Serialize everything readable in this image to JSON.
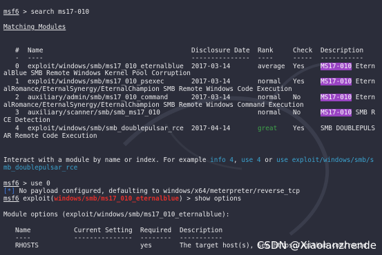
{
  "prompt": {
    "label": "msf6",
    "gt": " > ",
    "exploit_word": "exploit(",
    "exploit_module": "windows/smb/ms17_010_eternalblue",
    "close": ") > "
  },
  "commands": {
    "search": "search ms17-010",
    "use": "use 0",
    "show": "show options"
  },
  "matching": {
    "title": "Matching Modules",
    "headers": {
      "num": "#",
      "name": "Name",
      "date": "Disclosure Date",
      "rank": "Rank",
      "check": "Check",
      "desc": "Description"
    },
    "dashes": {
      "num": "-",
      "name": "----",
      "date": "---------------",
      "rank": "----",
      "check": "-----",
      "desc": "-----------"
    },
    "rows": [
      {
        "num": "0",
        "name": "exploit/windows/smb/ms17_010_eternalblue",
        "date": "2017-03-14",
        "rank": "average",
        "check": "Yes",
        "tag": "MS17-010",
        "desc_tail": " Etern",
        "wrap": "alBlue SMB Remote Windows Kernel Pool Corruption"
      },
      {
        "num": "1",
        "name": "exploit/windows/smb/ms17_010_psexec",
        "date": "2017-03-14",
        "rank": "normal",
        "check": "Yes",
        "tag": "MS17-010",
        "desc_tail": " Etern",
        "wrap": "alRomance/EternalSynergy/EternalChampion SMB Remote Windows Code Execution"
      },
      {
        "num": "2",
        "name": "auxiliary/admin/smb/ms17_010_command",
        "date": "2017-03-14",
        "rank": "normal",
        "check": "No",
        "tag": "MS17-010",
        "desc_tail": " Etern",
        "wrap": "alRomance/EternalSynergy/EternalChampion SMB Remote Windows Command Execution"
      },
      {
        "num": "3",
        "name": "auxiliary/scanner/smb/smb_ms17_010",
        "date": "",
        "rank": "normal",
        "check": "No",
        "tag": "MS17-010",
        "desc_tail": " SMB R",
        "wrap": "CE Detection"
      },
      {
        "num": "4",
        "name": "exploit/windows/smb/smb_doublepulsar_rce",
        "date": "2017-04-14",
        "rank": "great",
        "check": "Yes",
        "tag": "",
        "desc_tail": "SMB DOUBLEPULS",
        "wrap": "AR Remote Code Execution"
      }
    ]
  },
  "interact": {
    "text_a": "Interact with a module by name or index. For example ",
    "info": "info 4",
    "sep1": ", ",
    "use4": "use 4",
    "or": " or ",
    "use_path_a": "use exploit/windows/smb/s",
    "use_path_b": "mb_doublepulsar_rce"
  },
  "payload_msg": {
    "marker": "[*]",
    "text": " No payload configured, defaulting to windows/x64/meterpreter/reverse_tcp"
  },
  "options": {
    "title": "Module options (exploit/windows/smb/ms17_010_eternalblue):",
    "headers": {
      "name": "Name",
      "current": "Current Setting",
      "required": "Required",
      "desc": "Description"
    },
    "dashes": {
      "name": "----",
      "current": "---------------",
      "required": "--------",
      "desc": "-----------"
    },
    "rows": [
      {
        "name": "RHOSTS",
        "current": "",
        "required": "yes",
        "desc": "The target host(s), see https://github.com/rapid"
      }
    ]
  },
  "watermark": "CSDN @Xiaolanzhende",
  "colors": {
    "background": "#2b2d3a",
    "red": "#e0302c",
    "blue": "#3f7ee8",
    "cyan": "#3ba3cf",
    "green": "#3fa14a",
    "highlight": "#9a45c4"
  }
}
